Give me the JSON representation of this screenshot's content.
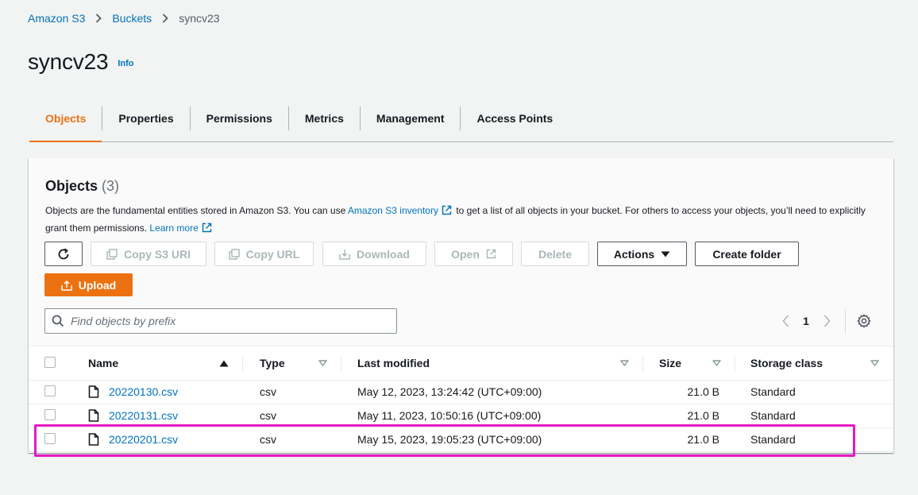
{
  "breadcrumb": [
    "Amazon S3",
    "Buckets",
    "syncv23"
  ],
  "page": {
    "title": "syncv23",
    "info_label": "Info"
  },
  "tabs": [
    "Objects",
    "Properties",
    "Permissions",
    "Metrics",
    "Management",
    "Access Points"
  ],
  "panel": {
    "title": "Objects",
    "count": "(3)",
    "desc_part1": "Objects are the fundamental entities stored in Amazon S3. You can use ",
    "desc_link1": "Amazon S3 inventory",
    "desc_part2": " to get a list of all objects in your bucket. For others to access your objects, you’ll need to explicitly grant them permissions. ",
    "desc_link2": "Learn more"
  },
  "toolbar": {
    "copy_s3_uri": "Copy S3 URI",
    "copy_url": "Copy URL",
    "download": "Download",
    "open": "Open",
    "delete": "Delete",
    "actions": "Actions",
    "create_folder": "Create folder",
    "upload": "Upload"
  },
  "search": {
    "placeholder": "Find objects by prefix"
  },
  "pagination": {
    "current_page": "1"
  },
  "table": {
    "columns": [
      "Name",
      "Type",
      "Last modified",
      "Size",
      "Storage class"
    ],
    "rows": [
      {
        "name": "20220130.csv",
        "type": "csv",
        "last_modified": "May 12, 2023, 13:24:42 (UTC+09:00)",
        "size": "21.0 B",
        "storage_class": "Standard"
      },
      {
        "name": "20220131.csv",
        "type": "csv",
        "last_modified": "May 11, 2023, 10:50:16 (UTC+09:00)",
        "size": "21.0 B",
        "storage_class": "Standard"
      },
      {
        "name": "20220201.csv",
        "type": "csv",
        "last_modified": "May 15, 2023, 19:05:23 (UTC+09:00)",
        "size": "21.0 B",
        "storage_class": "Standard"
      }
    ]
  },
  "colors": {
    "accent": "#ec7211",
    "link": "#0073bb",
    "highlight": "#e619c3"
  }
}
